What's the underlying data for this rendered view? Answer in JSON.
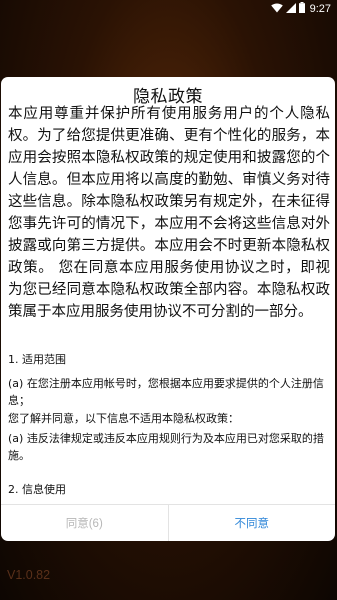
{
  "status_bar": {
    "time": "9:27",
    "icons": [
      "wifi-icon",
      "signal-icon",
      "battery-icon"
    ]
  },
  "dialog": {
    "title": "隐私政策",
    "intro": "本应用尊重并保护所有使用服务用户的个人隐私权。为了给您提供更准确、更有个性化的服务，本应用会按照本隐私权政策的规定使用和披露您的个人信息。但本应用将以高度的勤勉、审慎义务对待这些信息。除本隐私权政策另有规定外，在未征得您事先许可的情况下，本应用不会将这些信息对外披露或向第三方提供。本应用会不时更新本隐私权政策。 您在同意本应用服务使用协议之时，即视为您已经同意本隐私权政策全部内容。本隐私权政策属于本应用服务使用协议不可分割的一部分。",
    "section1_heading": "1. 适用范围",
    "item_a1": "(a) 在您注册本应用帐号时，您根据本应用要求提供的个人注册信息；",
    "notice": "您了解并同意，以下信息不适用本隐私权政策：",
    "item_a2": "(a) 违反法律规定或违反本应用规则行为及本应用已对您采取的措施。",
    "section2_heading": "2. 信息使用",
    "agree_label": "同意(6)",
    "disagree_label": "不同意"
  },
  "version": "V1.0.82",
  "colors": {
    "background": "#2a1204",
    "dialog_bg": "#ffffff",
    "disagree": "#2e86d8",
    "agree_disabled": "#b7b7b7"
  }
}
